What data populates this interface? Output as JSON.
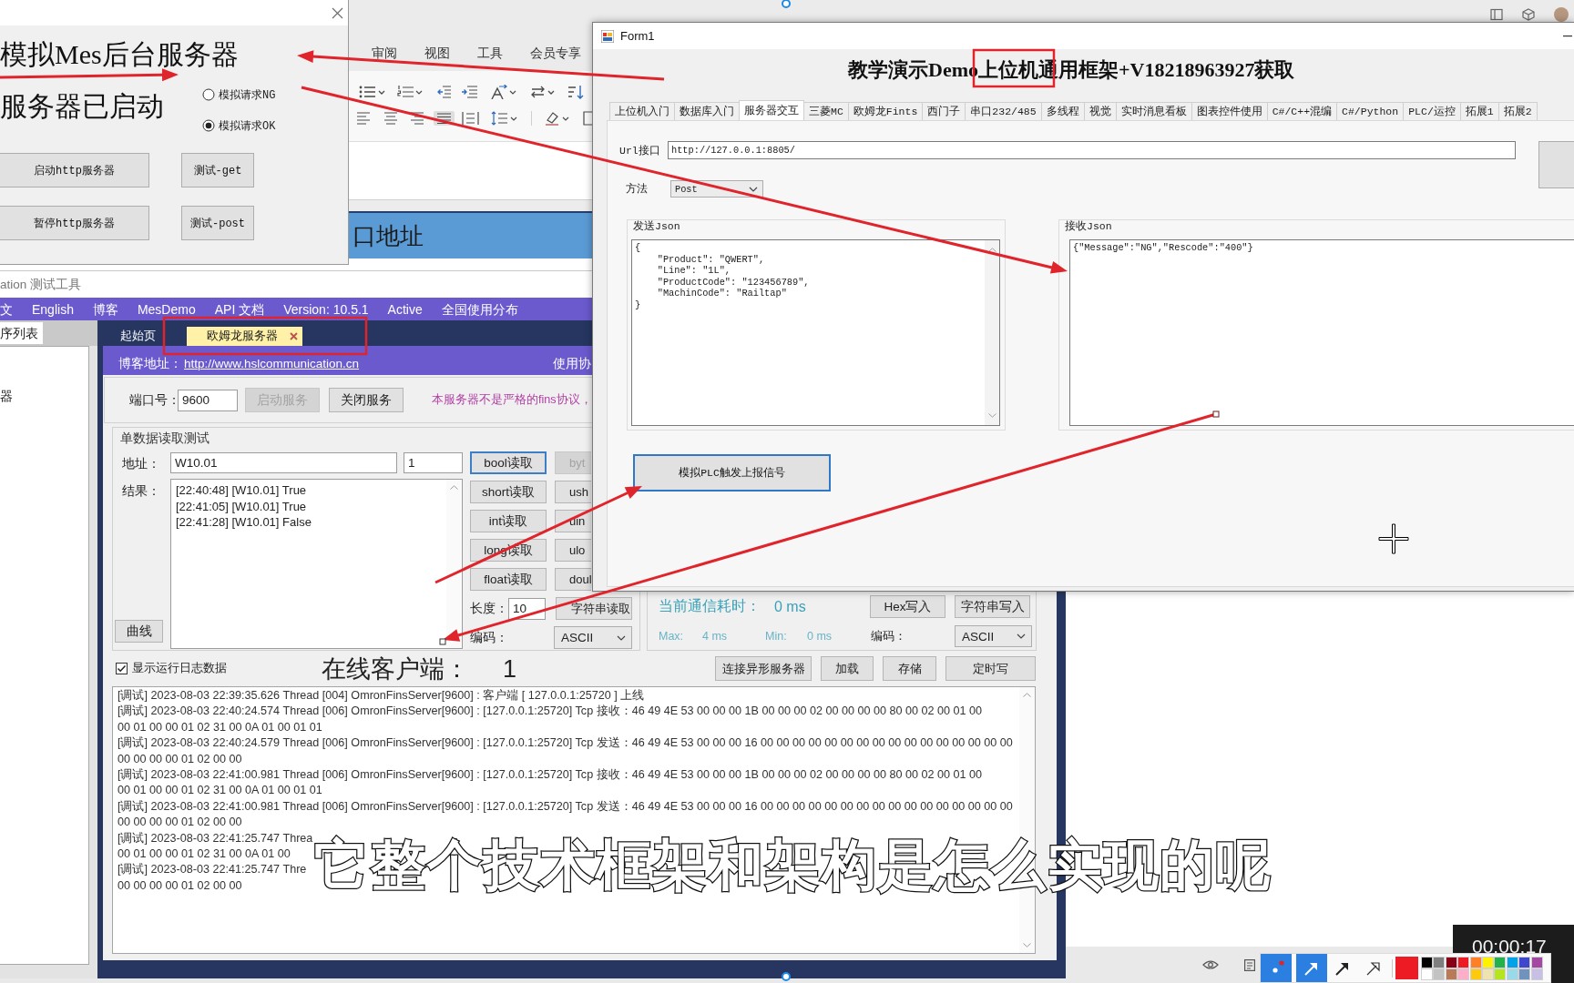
{
  "background_document": {
    "menu": [
      "审阅",
      "视图",
      "工具",
      "会员专享"
    ],
    "banner": "口地址"
  },
  "server_dialog": {
    "heading": "模拟Mes后台服务器",
    "status": "服务器已启动",
    "radios": [
      {
        "label": "模拟请求NG",
        "selected": false
      },
      {
        "label": "模拟请求OK",
        "selected": true
      }
    ],
    "buttons": [
      {
        "label": "启动http服务器",
        "kind": "wide"
      },
      {
        "label": "测试-get",
        "kind": "narrow"
      },
      {
        "label": "暂停http服务器",
        "kind": "wide"
      },
      {
        "label": "测试-post",
        "kind": "narrow"
      }
    ]
  },
  "form1": {
    "title": "Form1",
    "heading": "教学演示Demo上位机通用框架+V18218963927获取",
    "tabs": [
      {
        "label": "上位机入门",
        "selected": false
      },
      {
        "label": "数据库入门",
        "selected": false
      },
      {
        "label": "服务器交互",
        "selected": true
      },
      {
        "label": "三菱MC",
        "selected": false
      },
      {
        "label": "欧姆龙Fints",
        "selected": false
      },
      {
        "label": "西门子",
        "selected": false
      },
      {
        "label": "串口232/485",
        "selected": false
      },
      {
        "label": "多线程",
        "selected": false
      },
      {
        "label": "视觉",
        "selected": false
      },
      {
        "label": "实时消息看板",
        "selected": false
      },
      {
        "label": "图表控件使用",
        "selected": false
      },
      {
        "label": "C#/C++混编",
        "selected": false
      },
      {
        "label": "C#/Python",
        "selected": false
      },
      {
        "label": "PLC/运控",
        "selected": false
      },
      {
        "label": "拓展1",
        "selected": false
      },
      {
        "label": "拓展2",
        "selected": false
      }
    ],
    "url": {
      "label": "Url接口",
      "value": "http://127.0.0.1:8805/"
    },
    "method": {
      "label": "方法",
      "value": "Post"
    },
    "send_json": {
      "title": "发送Json",
      "lines": [
        "{",
        "    \"Product\": \"QWERT\",",
        "    \"Line\": \"1L\",",
        "    \"ProductCode\": \"123456789\",",
        "    \"MachinCode\": \"Railtap\"",
        "}"
      ]
    },
    "receive_json": {
      "title": "接收Json",
      "lines": [
        "{\"Message\":\"NG\",\"Rescode\":\"400\"}"
      ]
    },
    "trigger_button": "模拟PLC触发上报信号"
  },
  "hsl_tool": {
    "title": "ation 测试工具",
    "menu": [
      "文",
      "English",
      "博客",
      "MesDemo",
      "API 文档",
      "Version: 10.5.1",
      "Active",
      "全国使用分布"
    ],
    "side_tab": "序列表",
    "side_items": [
      "器"
    ],
    "doc_tabs": [
      {
        "label": "起始页",
        "selected": false
      },
      {
        "label": "欧姆龙服务器",
        "selected": true
      }
    ],
    "blog": {
      "label": "博客地址：",
      "link": "http://www.hslcommunication.cn",
      "usage": "使用协"
    },
    "port": {
      "label": "端口号：",
      "value": "9600",
      "buttons": [
        {
          "label": "启动服务",
          "disabled": true
        },
        {
          "label": "关闭服务",
          "disabled": false
        }
      ],
      "notice": "本服务器不是严格的fins协议，"
    },
    "single_read": {
      "title": "单数据读取测试",
      "address_label": "地址：",
      "address": "W10.01",
      "count": "1",
      "result_label": "结果：",
      "results": [
        "[22:40:48] [W10.01] True",
        "[22:41:05] [W10.01] True",
        "[22:41:28] [W10.01] False"
      ],
      "curve_button": "曲线",
      "read_rows": [
        {
          "buttons": [
            {
              "label": "bool读取",
              "focused": true,
              "disabled": false
            },
            {
              "label": "byt",
              "focused": false,
              "disabled": true
            }
          ]
        },
        {
          "buttons": [
            {
              "label": "short读取",
              "focused": false,
              "disabled": false
            },
            {
              "label": "ush",
              "focused": false,
              "disabled": false
            }
          ]
        },
        {
          "buttons": [
            {
              "label": "int读取",
              "focused": false,
              "disabled": false
            },
            {
              "label": "uin",
              "focused": false,
              "disabled": false
            }
          ]
        },
        {
          "buttons": [
            {
              "label": "long读取",
              "focused": false,
              "disabled": false
            },
            {
              "label": "ulo",
              "focused": false,
              "disabled": false
            }
          ]
        },
        {
          "buttons": [
            {
              "label": "float读取",
              "focused": false,
              "disabled": false
            },
            {
              "label": "doul",
              "focused": false,
              "disabled": false
            }
          ]
        }
      ],
      "length_label": "长度：",
      "length": "10",
      "string_read_button": "字符串读取",
      "encoding_label": "编码：",
      "encoding": "ASCII"
    },
    "comm": {
      "latency_label": "当前通信耗时：",
      "latency": "0 ms",
      "max_label": "Max:",
      "max": "4 ms",
      "min_label": "Min:",
      "min": "0 ms",
      "buttons": [
        "Hex写入",
        "字符串写入"
      ],
      "encoding_label": "编码：",
      "encoding": "ASCII"
    },
    "log_toggle": {
      "label": "显示运行日志数据",
      "checked": true
    },
    "online_label": "在线客户端：",
    "online_count": "1",
    "actions": [
      "连接异形服务器",
      "加载",
      "存储",
      "定时写"
    ],
    "log_lines": [
      "[调试] 2023-08-03 22:39:35.626 Thread [004] OmronFinsServer[9600] : 客户端 [ 127.0.0.1:25720 ] 上线",
      "[调试] 2023-08-03 22:40:24.574 Thread [006] OmronFinsServer[9600] : [127.0.0.1:25720] Tcp 接收：46 49 4E 53 00 00 00 1B 00 00 00 02 00 00 00 00 80 00 02 00 01 00",
      "00 01 00 00 01 02 31 00 0A 01 00 01 01",
      "[调试] 2023-08-03 22:40:24.579 Thread [006] OmronFinsServer[9600] : [127.0.0.1:25720] Tcp 发送：46 49 4E 53 00 00 00 16 00 00 00 00 00 00 00 00 00 00 00 00 00 00 00 00",
      "00 00 00 00 01 02 00 00",
      "[调试] 2023-08-03 22:41:00.981 Thread [006] OmronFinsServer[9600] : [127.0.0.1:25720] Tcp 接收：46 49 4E 53 00 00 00 1B 00 00 00 02 00 00 00 00 80 00 02 00 01 00",
      "00 01 00 00 01 02 31 00 0A 01 00 01 01",
      "[调试] 2023-08-03 22:41:00.981 Thread [006] OmronFinsServer[9600] : [127.0.0.1:25720] Tcp 发送：46 49 4E 53 00 00 00 16 00 00 00 00 00 00 00 00 00 00 00 00 00 00 00 00",
      "00 00 00 00 01 02 00 00",
      "[调试] 2023-08-03 22:41:25.747 Threa",
      "00 01 00 00 01 02 31 00 0A 01 00",
      "[调试] 2023-08-03 22:41:25.747 Thre",
      "00 00 00 00 01 02 00 00"
    ]
  },
  "subtitle": "它整个技术框架和架构是怎么实现的呢",
  "timer": "00:00:17",
  "drawing_toolbar": {
    "tools": [
      {
        "kind": "dot",
        "selected": true
      },
      {
        "kind": "arrow",
        "selected": true
      },
      {
        "kind": "arrow",
        "selected": false
      },
      {
        "kind": "outline-arrow",
        "selected": false
      }
    ],
    "current": {
      "color": "#ed1c24"
    },
    "palette": [
      {
        "color": "#000000"
      },
      {
        "color": "#7f7f7f"
      },
      {
        "color": "#880015"
      },
      {
        "color": "#ed1c24"
      },
      {
        "color": "#ff7f27"
      },
      {
        "color": "#fff200"
      },
      {
        "color": "#22b14c"
      },
      {
        "color": "#00a2e8"
      },
      {
        "color": "#3f48cc"
      },
      {
        "color": "#a349a4"
      },
      {
        "color": "#ffffff"
      },
      {
        "color": "#c3c3c3"
      },
      {
        "color": "#b97a57"
      },
      {
        "color": "#ffaec9"
      },
      {
        "color": "#ffc90e"
      },
      {
        "color": "#efe4b0"
      },
      {
        "color": "#b5e61d"
      },
      {
        "color": "#99d9ea"
      },
      {
        "color": "#7092be"
      },
      {
        "color": "#c8bfe7"
      }
    ]
  }
}
